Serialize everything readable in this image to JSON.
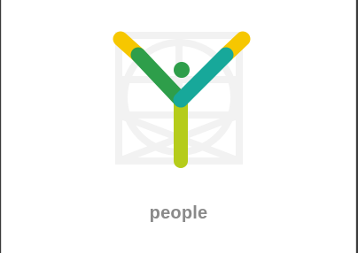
{
  "tile": {
    "caption": "people",
    "icon": "people-y-figure-icon"
  },
  "colors": {
    "background": "#ffffff",
    "caption": "#8a8a8a",
    "arm_yellow": "#f6c700",
    "arm_green": "#2e9e4a",
    "arm_teal": "#17a89a",
    "stem_lime": "#b5cc1a",
    "head_green": "#2e9e4a",
    "watermark": "#f2f2f2"
  }
}
